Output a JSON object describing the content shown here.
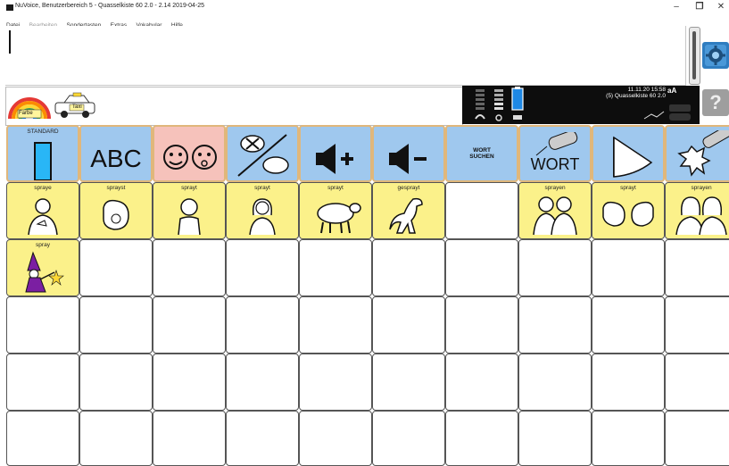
{
  "window": {
    "title": "NuVoice, Benutzerbereich 5 - Quasselkiste 60 2.0 - 2.14 2019-04-25",
    "controls": {
      "minimize": "–",
      "maximize": "❐",
      "close": "✕"
    }
  },
  "menu": [
    {
      "label": "Datei",
      "enabled": true
    },
    {
      "label": "Bearbeiten",
      "enabled": false
    },
    {
      "label": "Sondertasten",
      "enabled": true
    },
    {
      "label": "Extras",
      "enabled": true
    },
    {
      "label": "Vokabular",
      "enabled": true
    },
    {
      "label": "Hilfe",
      "enabled": true
    }
  ],
  "message": {
    "text": ""
  },
  "toolbar": {
    "rainbow_label": "Farbe",
    "taxi_label": "Taxi"
  },
  "status": {
    "datetime": "11.11.20 15:58",
    "page": "(5) Quasselkiste 60 2.0",
    "text_size": "aA"
  },
  "side_buttons": {
    "help": "?"
  },
  "nav_row": [
    {
      "label": "STANDARD",
      "icon": "standard-bar-icon"
    },
    {
      "label": "ABC",
      "icon": "abc-icon"
    },
    {
      "label": "",
      "icon": "faces-speaking-icon"
    },
    {
      "label": "",
      "icon": "speech-cancel-icon"
    },
    {
      "label": "",
      "icon": "volume-up-icon"
    },
    {
      "label": "",
      "icon": "volume-down-icon"
    },
    {
      "label": "WORT SUCHEN",
      "icon": "word-search-icon"
    },
    {
      "label": "WORT",
      "icon": "word-spray-icon"
    },
    {
      "label": "",
      "icon": "spray-fan-icon"
    },
    {
      "label": "",
      "icon": "spray-burst-icon"
    }
  ],
  "word_row_1": [
    "spraye",
    "sprayst",
    "sprayt",
    "sprayt",
    "sprayt",
    "gesprayt",
    "",
    "sprayen",
    "sprayt",
    "sprayen"
  ],
  "word_row_2": [
    "spray"
  ],
  "colors": {
    "nav_blue": "#9fc8ee",
    "nav_pink": "#f6c2bb",
    "word_yellow": "#fbf18a",
    "cell_border_orange": "#e0b77b",
    "status_black": "#0d0d0d"
  }
}
